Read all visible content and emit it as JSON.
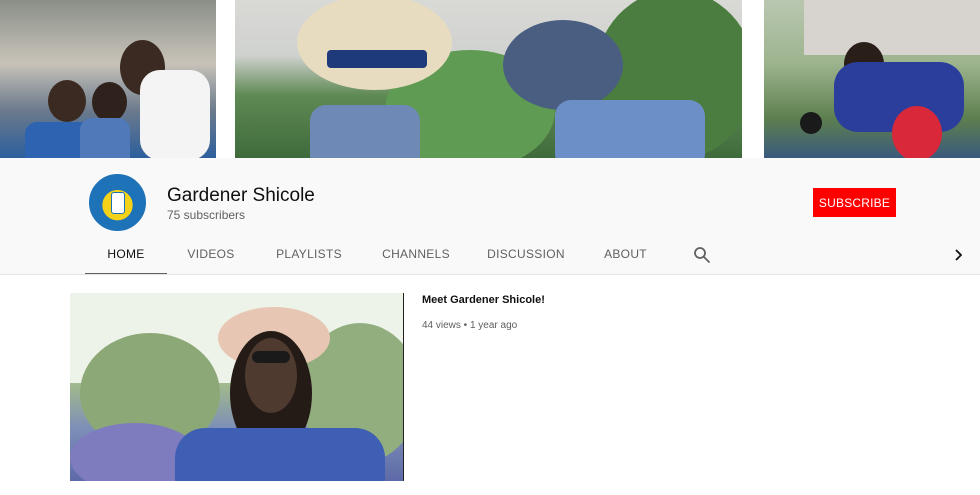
{
  "channel": {
    "name": "Gardener Shicole",
    "subscribers": "75 subscribers",
    "subscribe_label": "SUBSCRIBE"
  },
  "tabs": [
    {
      "label": "HOME",
      "active": true
    },
    {
      "label": "VIDEOS",
      "active": false
    },
    {
      "label": "PLAYLISTS",
      "active": false
    },
    {
      "label": "CHANNELS",
      "active": false
    },
    {
      "label": "DISCUSSION",
      "active": false
    },
    {
      "label": "ABOUT",
      "active": false
    }
  ],
  "icons": {
    "search": "search-icon",
    "next": "chevron-right-icon"
  },
  "featured_video": {
    "title": "Meet Gardener Shicole!",
    "meta": "44 views • 1 year ago"
  },
  "colors": {
    "subscribe": "#ff0000",
    "header_bg": "#f9f9f9",
    "tab_text": "#606060",
    "tab_active": "#0f0f0f"
  }
}
